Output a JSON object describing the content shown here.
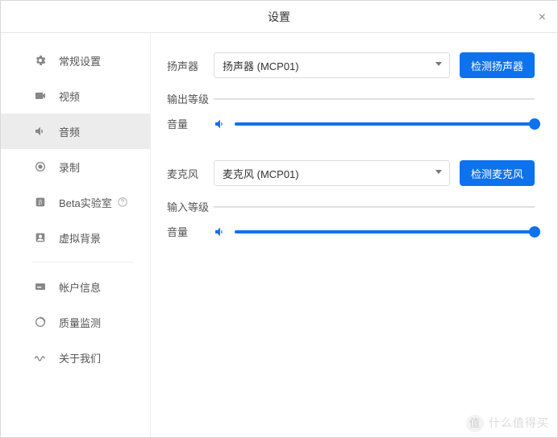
{
  "window": {
    "title": "设置"
  },
  "sidebar": {
    "items": [
      {
        "label": "常规设置"
      },
      {
        "label": "视频"
      },
      {
        "label": "音频"
      },
      {
        "label": "录制"
      },
      {
        "label": "Beta实验室"
      },
      {
        "label": "虚拟背景"
      },
      {
        "label": "帐户信息"
      },
      {
        "label": "质量监测"
      },
      {
        "label": "关于我们"
      }
    ],
    "active_index": 2
  },
  "audio": {
    "speaker": {
      "label": "扬声器",
      "selected": "扬声器 (MCP01)",
      "test_button": "检测扬声器",
      "output_level_label": "输出等级",
      "volume_label": "音量",
      "volume_percent": 100
    },
    "mic": {
      "label": "麦克风",
      "selected": "麦克风 (MCP01)",
      "test_button": "检测麦克风",
      "input_level_label": "输入等级",
      "volume_label": "音量",
      "volume_percent": 100
    }
  },
  "watermark": "什么值得买",
  "colors": {
    "primary": "#0e72ed"
  }
}
